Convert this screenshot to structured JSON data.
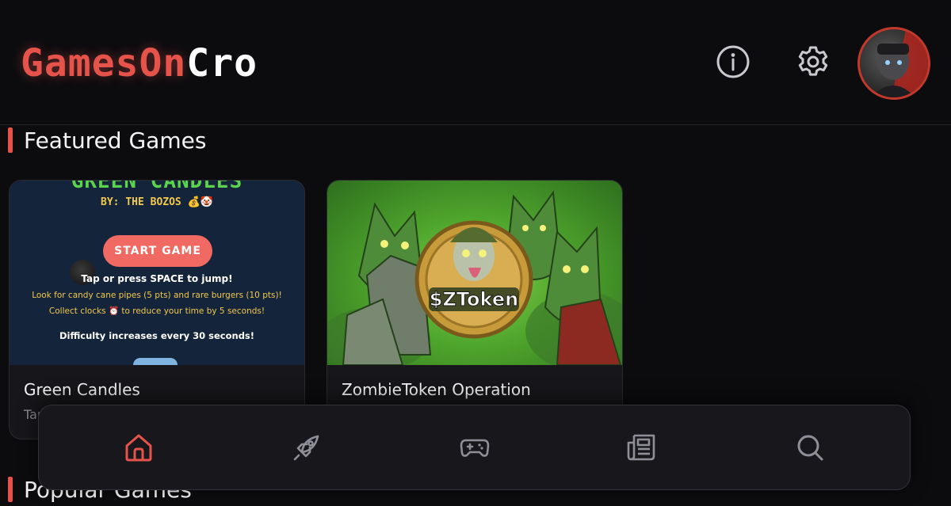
{
  "header": {
    "logo_accent": "GamesOn",
    "logo_plain": "Cro",
    "info_icon": "info-icon",
    "settings_icon": "gear-icon",
    "avatar_icon": "avatar"
  },
  "featured": {
    "title": "Featured Games",
    "games": [
      {
        "name": "Green Candles",
        "description": "Tap",
        "thumbnail": {
          "title": "GREEN CANDLES",
          "byline": "BY: THE BOZOS 💰🤡",
          "start_label": "START GAME",
          "tap_text": "Tap or press SPACE to jump!",
          "line1": "Look for candy cane pipes (5 pts) and rare burgers (10 pts)!",
          "line2": "Collect clocks ⏰ to reduce your time by 5 seconds!",
          "difficulty": "Difficulty increases every 30 seconds!"
        }
      },
      {
        "name": "ZombieToken Operation",
        "description": "",
        "thumbnail": {
          "coin_text": "$ZToken"
        }
      }
    ]
  },
  "popular": {
    "title": "Popular Games"
  },
  "bottom_nav": {
    "items": [
      {
        "icon": "home-icon",
        "active": true
      },
      {
        "icon": "rocket-icon",
        "active": false
      },
      {
        "icon": "gamepad-icon",
        "active": false
      },
      {
        "icon": "newspaper-icon",
        "active": false
      },
      {
        "icon": "search-icon",
        "active": false
      }
    ]
  },
  "colors": {
    "accent": "#e5534b",
    "background": "#0c0c0f",
    "card": "#17171b",
    "icon_inactive": "#8f8f98"
  }
}
